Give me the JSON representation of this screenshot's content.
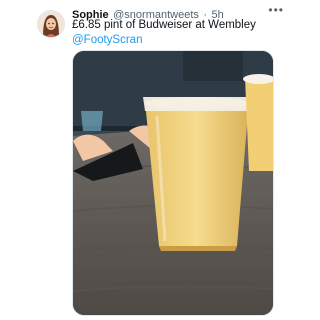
{
  "tweet": {
    "display_name": "Sophie",
    "handle": "@snormantweets",
    "separator": "·",
    "time": "5h",
    "text": "£6.85 pint of Budweiser at Wembley",
    "mention": "@FootyScran"
  },
  "icons": {
    "avatar": "avatar-cartoon-woman",
    "more": "more-horizontal-icon"
  }
}
